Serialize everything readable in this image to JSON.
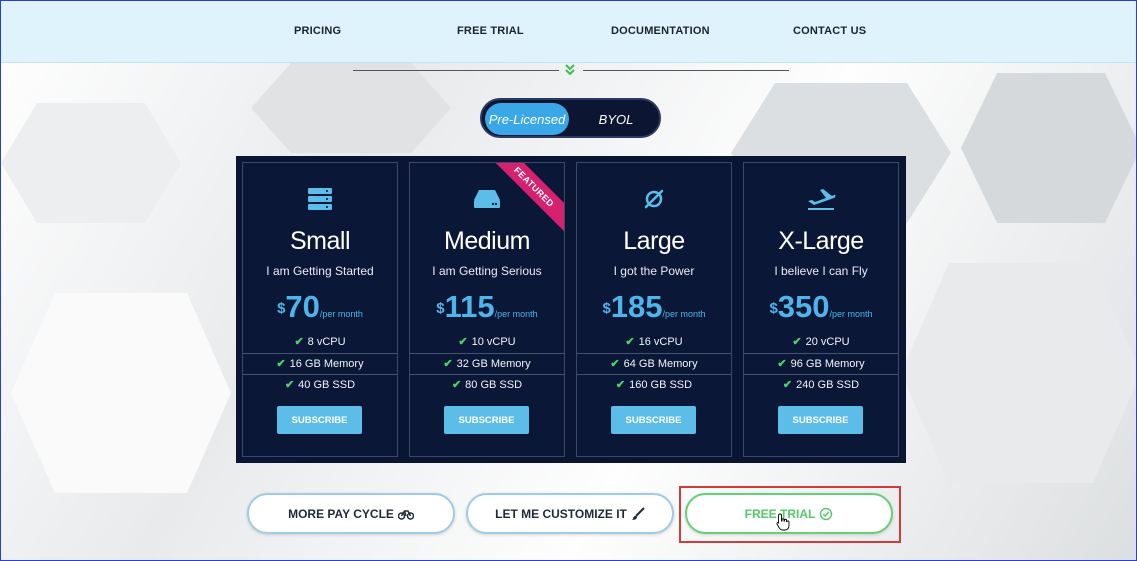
{
  "nav": {
    "items": [
      {
        "label": "PRICING"
      },
      {
        "label": "FREE TRIAL"
      },
      {
        "label": "DOCUMENTATION"
      },
      {
        "label": "CONTACT US"
      }
    ]
  },
  "toggle": {
    "options": [
      {
        "label": "Pre-Licensed",
        "active": true
      },
      {
        "label": "BYOL",
        "active": false
      }
    ]
  },
  "plans": [
    {
      "icon": "server-icon",
      "name": "Small",
      "tagline": "I am Getting Started",
      "currency": "$",
      "price": "70",
      "period": "/per month",
      "features": [
        "8 vCPU",
        "16 GB Memory",
        "40 GB SSD"
      ],
      "button": "SUBSCRIBE"
    },
    {
      "icon": "hard-drive-icon",
      "name": "Medium",
      "tagline": "I am Getting Serious",
      "currency": "$",
      "price": "115",
      "period": "/per month",
      "features": [
        "10 vCPU",
        "32 GB Memory",
        "80 GB SSD"
      ],
      "button": "SUBSCRIBE",
      "ribbon": "FEATURED"
    },
    {
      "icon": "orbit-icon",
      "name": "Large",
      "tagline": "I got the Power",
      "currency": "$",
      "price": "185",
      "period": "/per month",
      "features": [
        "16 vCPU",
        "64 GB Memory",
        "160 GB SSD"
      ],
      "button": "SUBSCRIBE"
    },
    {
      "icon": "plane-icon",
      "name": "X-Large",
      "tagline": "I believe I can Fly",
      "currency": "$",
      "price": "350",
      "period": "/per month",
      "features": [
        "20 vCPU",
        "96 GB Memory",
        "240 GB SSD"
      ],
      "button": "SUBSCRIBE"
    }
  ],
  "actions": {
    "more_pay_cycle": "MORE PAY CYCLE",
    "customize": "LET ME CUSTOMIZE IT",
    "free_trial": "FREE TRIAL"
  },
  "colors": {
    "nav_bg": "#dff3fd",
    "panel_bg": "#0a1533",
    "accent": "#4fb4ea",
    "ribbon": "#d6216f",
    "check": "#4ed26a",
    "free_trial_green": "#54c86a",
    "highlight": "#d03b3b"
  }
}
